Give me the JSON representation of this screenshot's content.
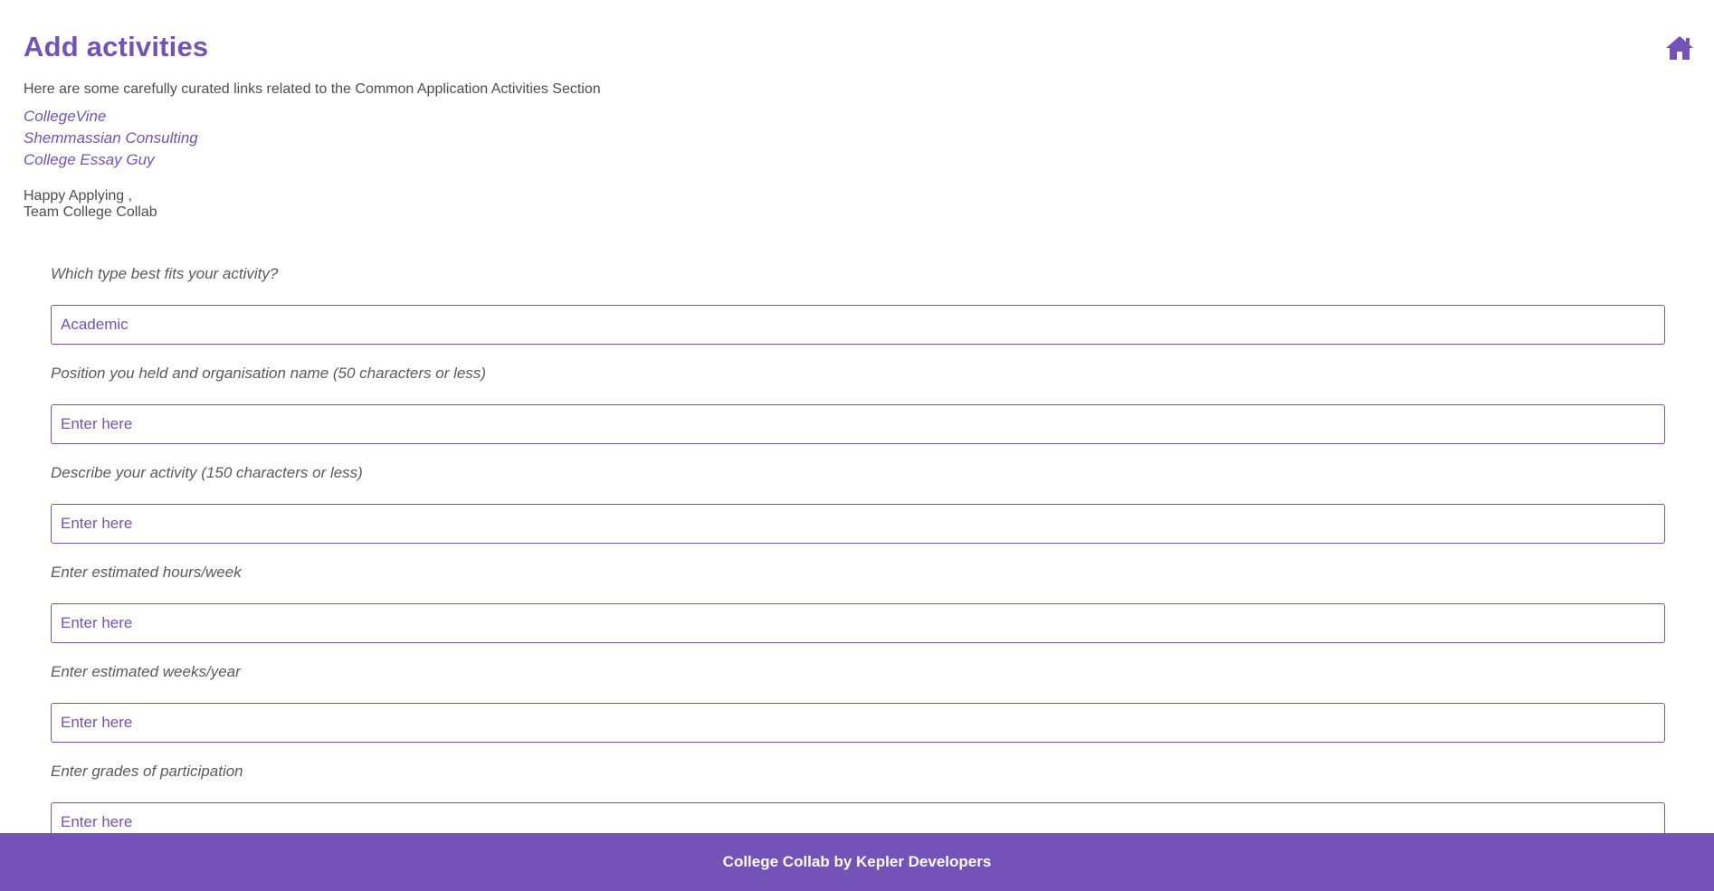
{
  "header": {
    "title": "Add activities"
  },
  "intro": {
    "text": "Here are some carefully curated links related to the Common Application Activities Section"
  },
  "links": [
    {
      "label": "CollegeVine"
    },
    {
      "label": "Shemmassian Consulting"
    },
    {
      "label": "College Essay Guy"
    }
  ],
  "signoff": {
    "line1": "Happy Applying ,",
    "line2": "Team College Collab"
  },
  "form": {
    "fields": [
      {
        "label": "Which type best fits your activity?",
        "value": "Academic",
        "placeholder": ""
      },
      {
        "label": "Position you held and organisation name (50 characters or less)",
        "value": "",
        "placeholder": "Enter here"
      },
      {
        "label": "Describe your activity (150 characters or less)",
        "value": "",
        "placeholder": "Enter here"
      },
      {
        "label": "Enter estimated hours/week",
        "value": "",
        "placeholder": "Enter here"
      },
      {
        "label": "Enter estimated weeks/year",
        "value": "",
        "placeholder": "Enter here"
      },
      {
        "label": "Enter grades of participation",
        "value": "",
        "placeholder": "Enter here"
      }
    ]
  },
  "footer": {
    "text": "College Collab by Kepler Developers"
  },
  "icons": {
    "home": "home-icon"
  },
  "colors": {
    "accent": "#7353b8",
    "text": "#4d4d4d"
  }
}
